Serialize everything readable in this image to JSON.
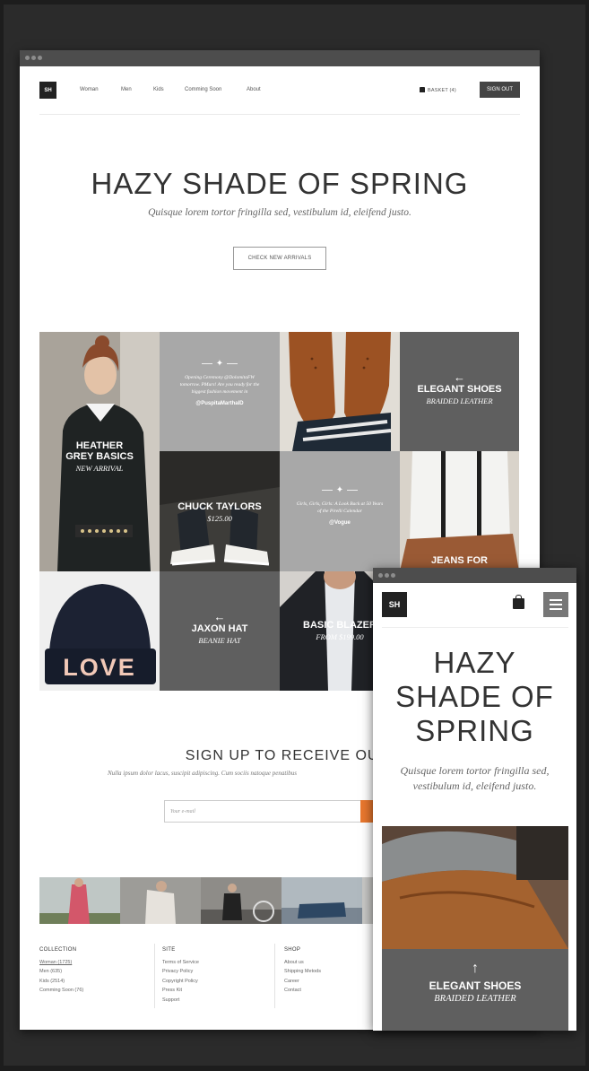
{
  "brand": {
    "logo": "SH"
  },
  "nav": {
    "links": [
      "Woman",
      "Men",
      "Kids",
      "Comming Soon",
      "About"
    ],
    "basket": "BASKET (4)",
    "signout": "SIGN OUT"
  },
  "hero": {
    "title": "HAZY SHADE OF SPRING",
    "subtitle": "Quisque lorem tortor fringilla sed, vestibulum id, eleifend justo.",
    "cta": "CHECK NEW ARRIVALS"
  },
  "grid": {
    "heather": {
      "title1": "HEATHER",
      "title2": "GREY BASICS",
      "sub": "NEW ARRIVAL"
    },
    "tweet1": {
      "text": "Opening Ceremony @DolomitaFW tomorrow. PMurs! Are you ready for the biggest fashion movement in",
      "handle": "@PuspitaMarthaID"
    },
    "elegant": {
      "arrow": "←",
      "title": "ELEGANT SHOES",
      "sub": "BRAIDED LEATHER"
    },
    "chuck": {
      "title": "CHUCK TAYLORS",
      "sub": "$125.00"
    },
    "tweet2": {
      "text": "Girls, Girls, Girls: A Look Back at 50 Years of the Pirelli Calendar",
      "handle": "@Vogue"
    },
    "jeans": {
      "title": "JEANS FOR"
    },
    "jaxon": {
      "arrow": "←",
      "title": "JAXON HAT",
      "sub": "BEANIE HAT"
    },
    "blazer": {
      "title": "BASIC BLAZER",
      "sub": "FROM $199.00"
    },
    "love": {
      "text": "LOVE"
    }
  },
  "signup": {
    "title": "SIGN UP TO RECEIVE OUR UPD",
    "subtitle": "Nulla ipsum dolor lacus, suscipit adipiscing. Cum sociis natoque penatibus",
    "placeholder": "Your e-mail"
  },
  "footer": {
    "collection": {
      "heading": "COLLECTION",
      "items": [
        "Woman (1725)",
        "Men (635)",
        "Kids (2514)",
        "Comming Soon (76)"
      ]
    },
    "site": {
      "heading": "SITE",
      "items": [
        "Terms of Service",
        "Privacy Policy",
        "Copyright Policy",
        "Press Kit",
        "Support"
      ]
    },
    "shop": {
      "heading": "SHOP",
      "items": [
        "About us",
        "Shipping Metods",
        "Career",
        "Contact"
      ]
    }
  },
  "mobile": {
    "logo": "SH",
    "title_lines": [
      "HAZY",
      "SHADE OF",
      "SPRING"
    ],
    "subtitle": "Quisque lorem tortor fringilla sed, vestibulum id, eleifend justo.",
    "panel": {
      "arrow": "↑",
      "title": "ELEGANT SHOES",
      "sub": "BRAIDED LEATHER"
    }
  },
  "colors": {
    "accent": "#e8772e",
    "tile_dark": "#5f5f5f",
    "tile_light": "#a8a8a8"
  }
}
